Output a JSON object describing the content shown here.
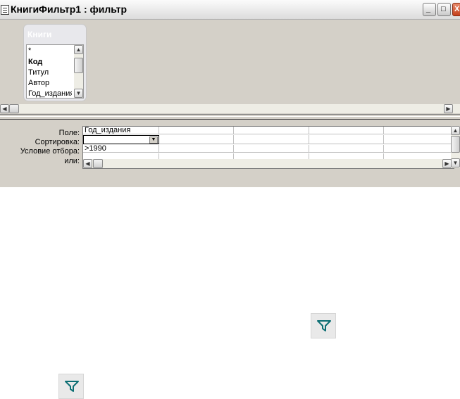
{
  "window": {
    "title": "КнигиФильтр1 : фильтр",
    "minimize_glyph": "_",
    "maximize_glyph": "□",
    "close_glyph": "X"
  },
  "table": {
    "name": "Книги",
    "fields": [
      {
        "label": "*",
        "bold": false
      },
      {
        "label": "Код",
        "bold": true
      },
      {
        "label": "Титул",
        "bold": false
      },
      {
        "label": "Автор",
        "bold": false
      },
      {
        "label": "Год_издания",
        "bold": false
      }
    ]
  },
  "grid": {
    "row_labels": [
      "Поле:",
      "Сортировка:",
      "Условие отбора:",
      "или:"
    ],
    "columns": [
      {
        "field": "Год_издания",
        "sort": "",
        "criteria": ">1990",
        "or": ""
      },
      {
        "field": "",
        "sort": "",
        "criteria": "",
        "or": ""
      },
      {
        "field": "",
        "sort": "",
        "criteria": "",
        "or": ""
      },
      {
        "field": "",
        "sort": "",
        "criteria": "",
        "or": ""
      },
      {
        "field": "",
        "sort": "",
        "criteria": "",
        "or": ""
      }
    ]
  },
  "icons": {
    "filter_icon_color": "#0b6e73",
    "accent_title_color": "#d4d0c8"
  }
}
